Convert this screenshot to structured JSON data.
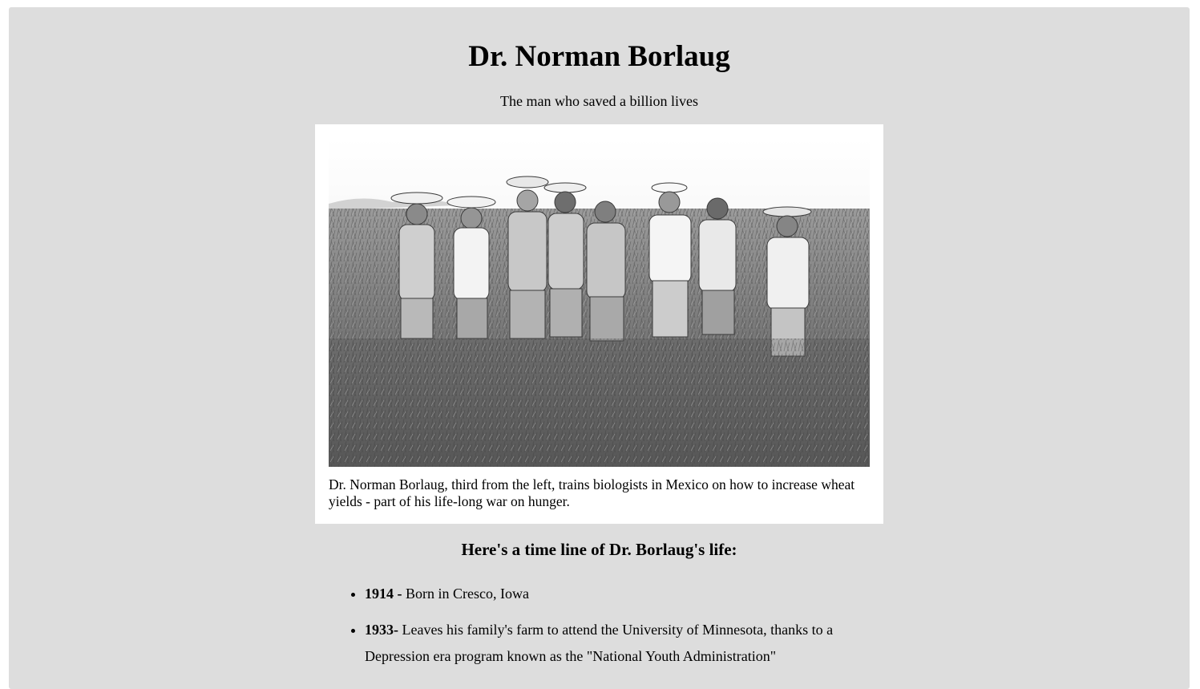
{
  "header": {
    "title": "Dr. Norman Borlaug",
    "subtitle": "The man who saved a billion lives"
  },
  "figure": {
    "photo_name": "borlaug-training-biologists-photo",
    "caption": "Dr. Norman Borlaug, third from the left, trains biologists in Mexico on how to increase wheat yields - part of his life-long war on hunger."
  },
  "timeline": {
    "heading": "Here's a time line of Dr. Borlaug's life:",
    "items": [
      {
        "year": "1914 -",
        "text": " Born in Cresco, Iowa"
      },
      {
        "year": "1933-",
        "text": " Leaves his family's farm to attend the University of Minnesota, thanks to a Depression era program known as the \"National Youth Administration\""
      }
    ]
  },
  "colors": {
    "page_background": "#dddddd",
    "image_frame": "#ffffff"
  }
}
